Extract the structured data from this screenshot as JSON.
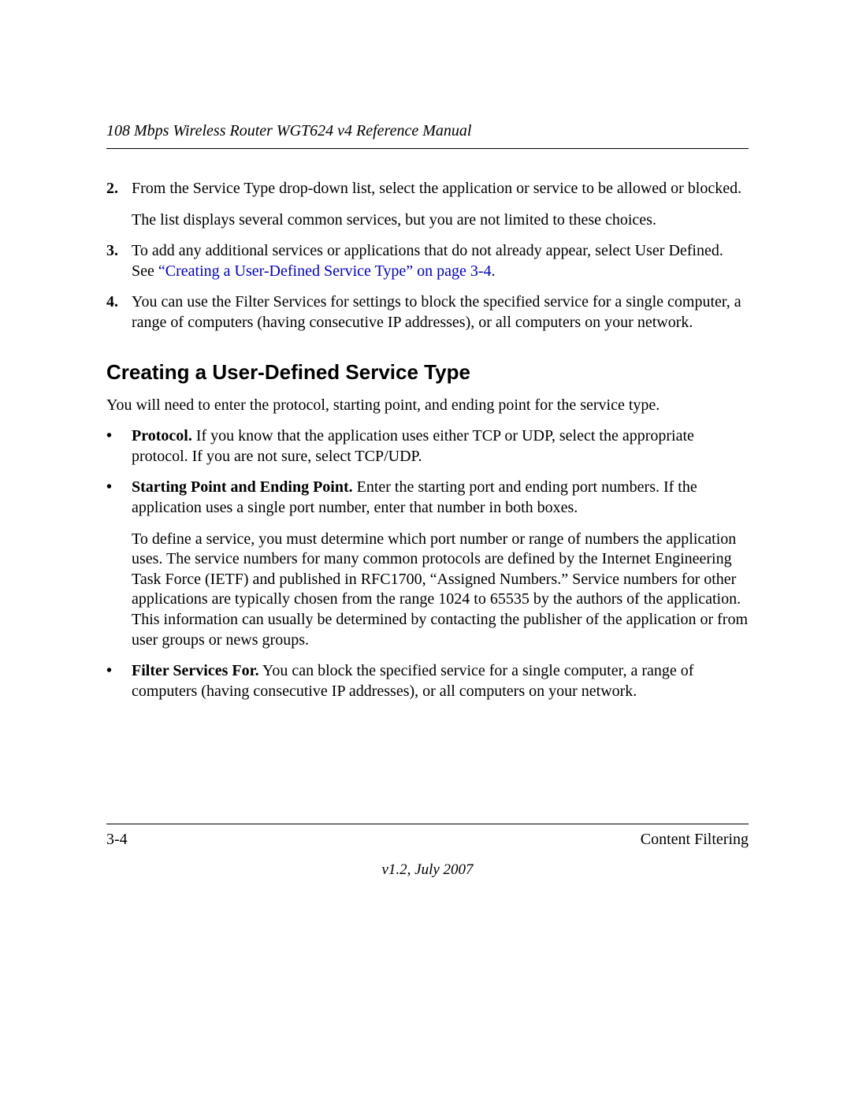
{
  "header": {
    "running_title": "108 Mbps Wireless Router WGT624 v4 Reference Manual"
  },
  "steps": {
    "item2": {
      "num": "2.",
      "text": "From the Service Type drop-down list, select the application or service to be allowed or blocked.",
      "sub": "The list displays several common services, but you are not limited to these choices."
    },
    "item3": {
      "num": "3.",
      "lead": "To add any additional services or applications that do not already appear, select User Defined. See ",
      "xref": "“Creating a User-Defined Service Type” on page 3-4",
      "tail": "."
    },
    "item4": {
      "num": "4.",
      "text": "You can use the Filter Services for settings to block the specified service for a single computer, a range of computers (having consecutive IP addresses), or all computers on your network."
    }
  },
  "section": {
    "heading": "Creating a User-Defined Service Type",
    "intro": "You will need to enter the protocol, starting point, and ending point for the service type."
  },
  "bullets": {
    "b1": {
      "label": "Protocol.",
      "text": " If you know that the application uses either TCP or UDP, select the appropriate protocol. If you are not sure, select TCP/UDP."
    },
    "b2": {
      "label": "Starting Point and Ending Point.",
      "text": " Enter the starting port and ending port numbers. If the application uses a single port number, enter that number in both boxes.",
      "sub": "To define a service, you must determine which port number or range of numbers the application uses. The service numbers for many common protocols are defined by the Internet Engineering Task Force (IETF) and published in RFC1700, “Assigned Numbers.” Service numbers for other applications are typically chosen from the range 1024 to 65535 by the authors of the application. This information can usually be determined by contacting the publisher of the application or from user groups or news groups."
    },
    "b3": {
      "label": "Filter Services For.",
      "text": " You can block the specified service for a single computer, a range of computers (having consecutive IP addresses), or all computers on your network."
    }
  },
  "footer": {
    "page_number": "3-4",
    "chapter": "Content Filtering",
    "version": "v1.2, July 2007"
  }
}
